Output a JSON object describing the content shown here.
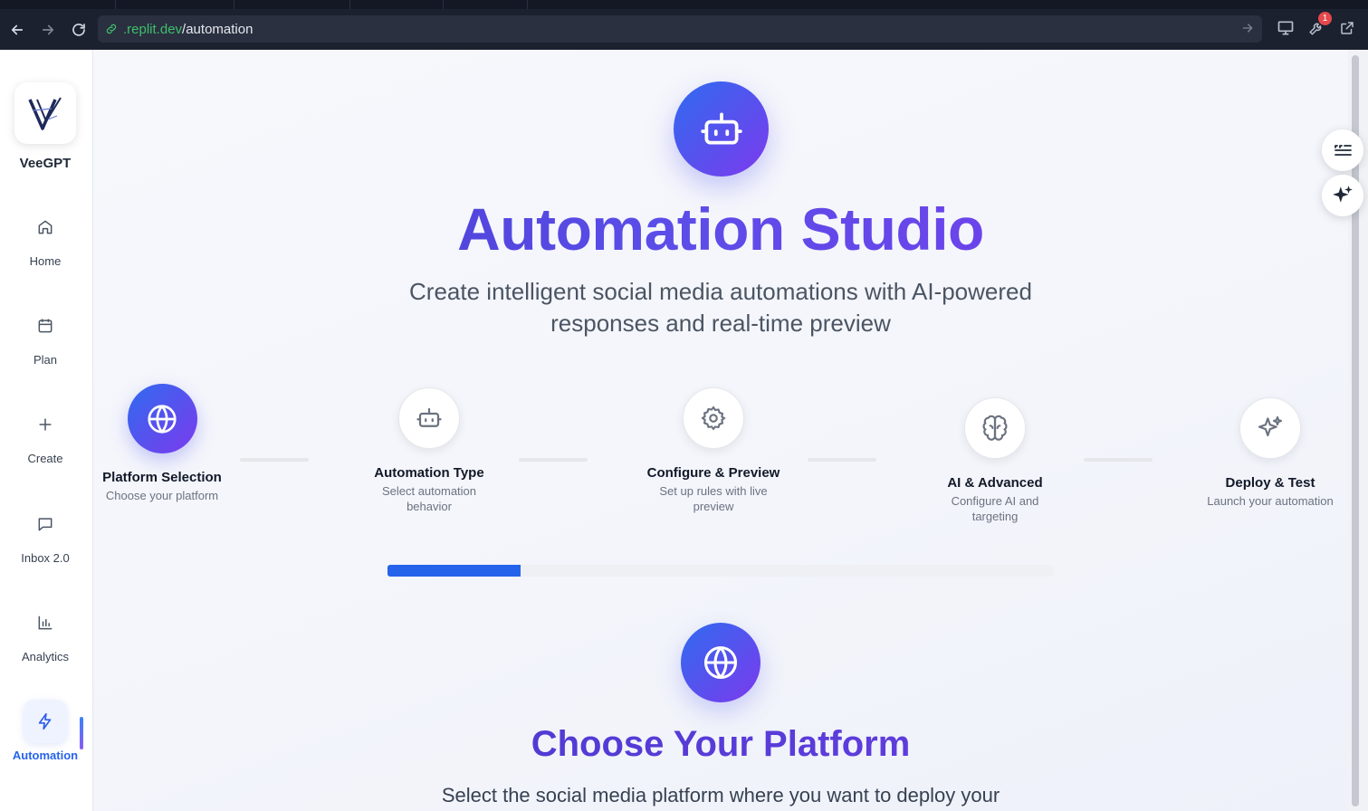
{
  "browser": {
    "url_host": ".replit.dev",
    "url_path": "/automation",
    "notification_count": "1"
  },
  "sidebar": {
    "brand": "VeeGPT",
    "items": [
      {
        "label": "Home",
        "icon": "home-icon"
      },
      {
        "label": "Plan",
        "icon": "calendar-icon"
      },
      {
        "label": "Create",
        "icon": "plus-icon"
      },
      {
        "label": "Inbox 2.0",
        "icon": "message-icon"
      },
      {
        "label": "Analytics",
        "icon": "bar-chart-icon"
      },
      {
        "label": "Automation",
        "icon": "lightning-icon",
        "active": true
      }
    ]
  },
  "hero": {
    "title": "Automation Studio",
    "subtitle": "Create intelligent social media automations with AI-powered responses and real-time preview"
  },
  "steps": [
    {
      "title": "Platform Selection",
      "desc": "Choose your platform",
      "icon": "globe-icon",
      "active": true
    },
    {
      "title": "Automation Type",
      "desc": "Select automation behavior",
      "icon": "bot-icon"
    },
    {
      "title": "Configure & Preview",
      "desc": "Set up rules with live preview",
      "icon": "gear-icon"
    },
    {
      "title": "AI & Advanced",
      "desc": "Configure AI and targeting",
      "icon": "brain-icon"
    },
    {
      "title": "Deploy & Test",
      "desc": "Launch your automation",
      "icon": "sparkle-icon"
    }
  ],
  "progress": {
    "value_percent": 20,
    "color": "#2563eb"
  },
  "section": {
    "title": "Choose Your Platform",
    "subtitle": "Select the social media platform where you want to deploy your"
  },
  "colors": {
    "accent_start": "#2f6bf0",
    "accent_end": "#7c3aed",
    "active_nav": "#2563eb"
  }
}
